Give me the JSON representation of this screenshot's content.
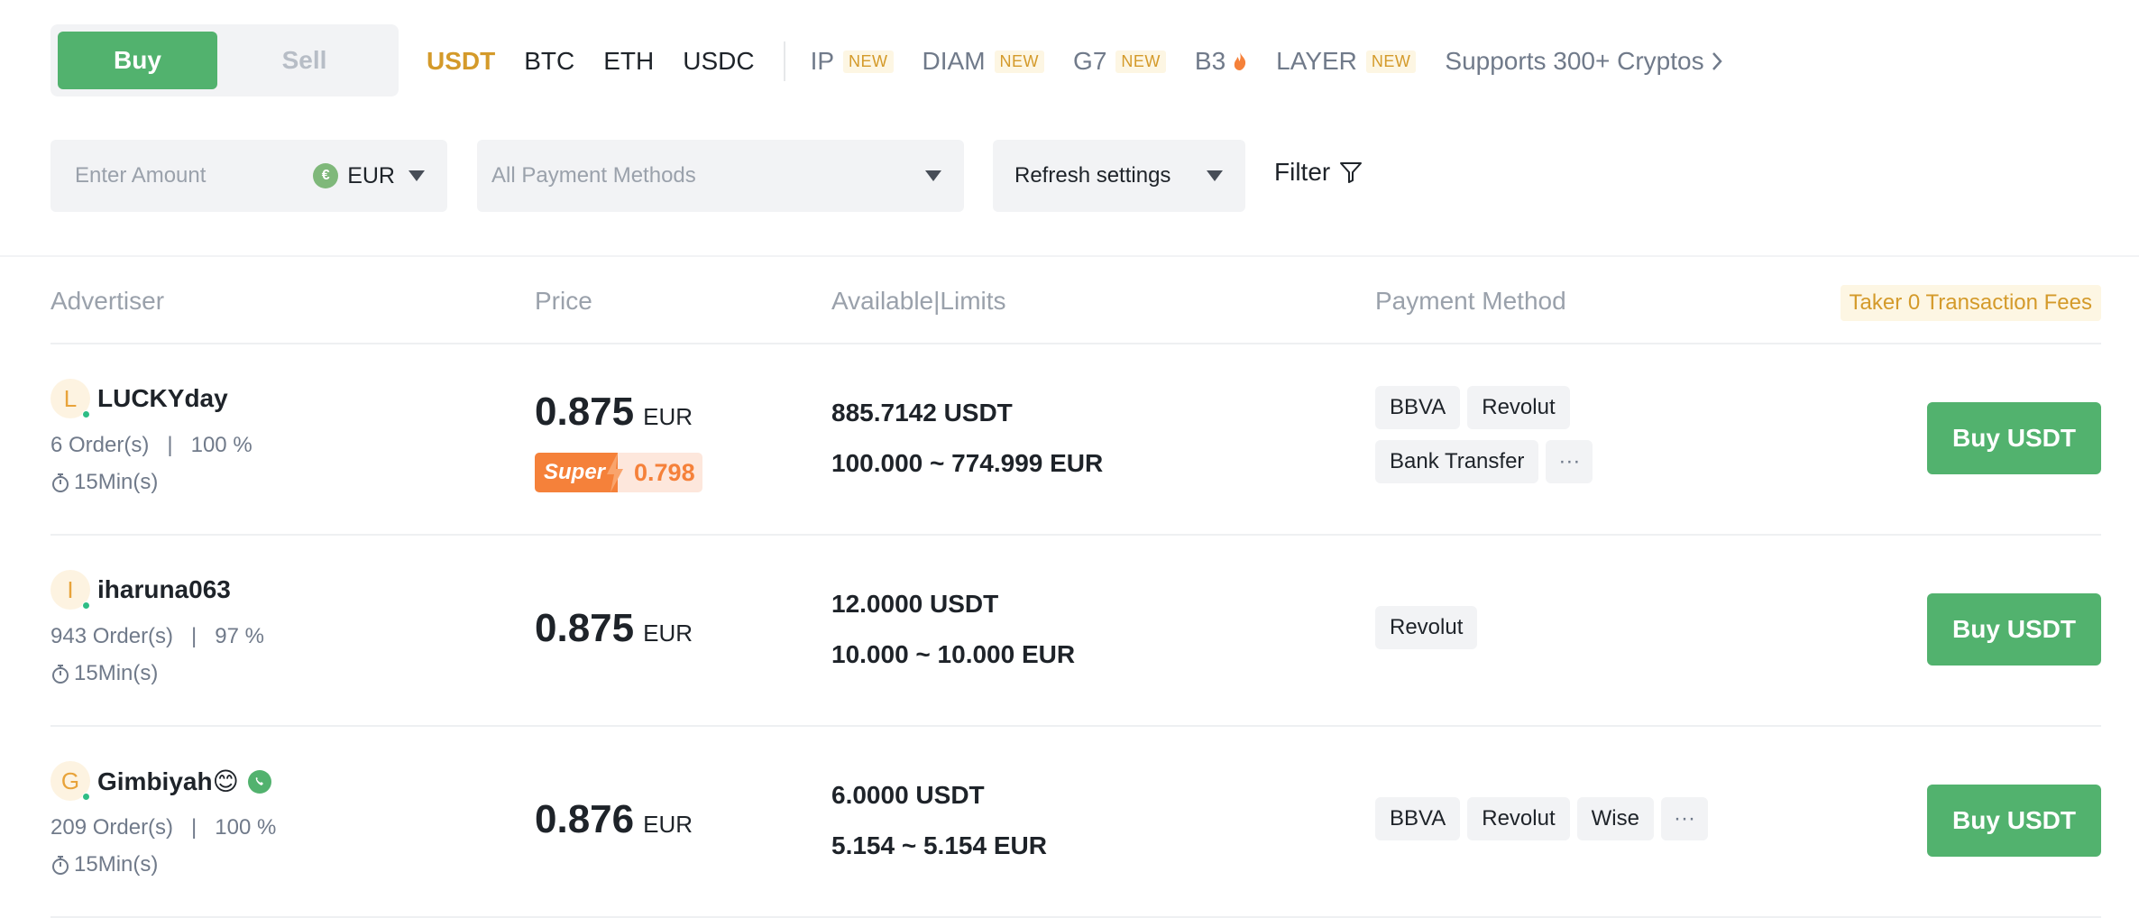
{
  "tabs": {
    "buy": "Buy",
    "sell": "Sell"
  },
  "coins": [
    {
      "label": "USDT",
      "badge": ""
    },
    {
      "label": "BTC",
      "badge": ""
    },
    {
      "label": "ETH",
      "badge": ""
    },
    {
      "label": "USDC",
      "badge": ""
    },
    {
      "label": "IP",
      "badge": "NEW"
    },
    {
      "label": "DIAM",
      "badge": "NEW"
    },
    {
      "label": "G7",
      "badge": "NEW"
    },
    {
      "label": "B3",
      "badge": ""
    },
    {
      "label": "LAYER",
      "badge": "NEW"
    }
  ],
  "supports_label": "Supports 300+ Cryptos",
  "filters": {
    "amount_placeholder": "Enter Amount",
    "currency": "EUR",
    "currency_symbol": "€",
    "payment_placeholder": "All Payment Methods",
    "refresh_label": "Refresh settings",
    "filter_label": "Filter"
  },
  "table": {
    "headers": {
      "advertiser": "Advertiser",
      "price": "Price",
      "available": "Available|Limits",
      "payment": "Payment Method"
    },
    "taker_note": "Taker 0 Transaction Fees",
    "rows": [
      {
        "initial": "L",
        "name": "LUCKYday",
        "orders": "6 Order(s)",
        "completion": "100 %",
        "time": "15Min(s)",
        "price": "0.875",
        "price_unit": "EUR",
        "super_label": "Super",
        "super_price": "0.798",
        "available": "885.7142 USDT",
        "limits": "100.000 ~ 774.999 EUR",
        "methods": [
          "BBVA",
          "Revolut",
          "Bank Transfer"
        ],
        "more": "···",
        "button": "Buy USDT"
      },
      {
        "initial": "I",
        "name": "iharuna063",
        "orders": "943 Order(s)",
        "completion": "97 %",
        "time": "15Min(s)",
        "price": "0.875",
        "price_unit": "EUR",
        "available": "12.0000 USDT",
        "limits": "10.000 ~ 10.000 EUR",
        "methods": [
          "Revolut"
        ],
        "button": "Buy USDT"
      },
      {
        "initial": "G",
        "name": "Gimbiyah😊",
        "orders": "209 Order(s)",
        "completion": "100 %",
        "time": "15Min(s)",
        "price": "0.876",
        "price_unit": "EUR",
        "available": "6.0000 USDT",
        "limits": "5.154 ~ 5.154 EUR",
        "methods": [
          "BBVA",
          "Revolut",
          "Wise"
        ],
        "more": "···",
        "button": "Buy USDT"
      }
    ]
  },
  "colors": {
    "accent": "#52b26e",
    "highlight": "#d49a2a",
    "super": "#f5813a"
  }
}
